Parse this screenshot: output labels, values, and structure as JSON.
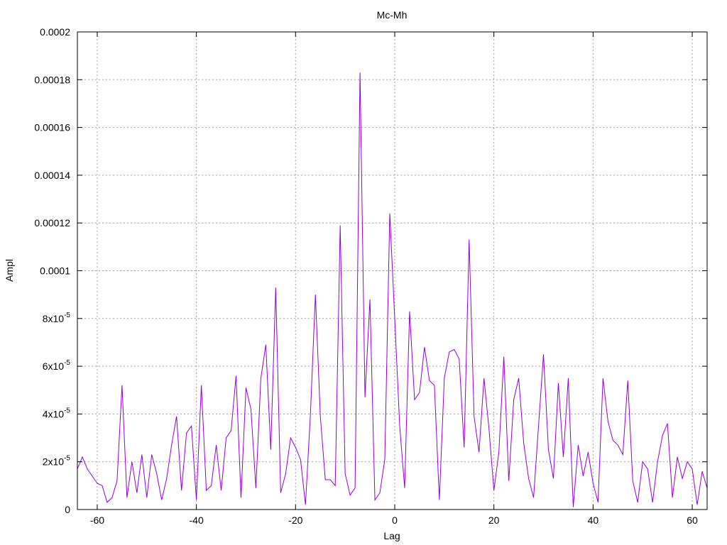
{
  "chart_data": {
    "type": "line",
    "title": "Mc-Mh",
    "xlabel": "Lag",
    "ylabel": "Ampl",
    "xlim": [
      -64,
      63
    ],
    "ylim": [
      0,
      0.0002
    ],
    "grid": true,
    "x_ticks": [
      {
        "value": -60,
        "label": "-60"
      },
      {
        "value": -40,
        "label": "-40"
      },
      {
        "value": -20,
        "label": "-20"
      },
      {
        "value": 0,
        "label": "0"
      },
      {
        "value": 20,
        "label": "20"
      },
      {
        "value": 40,
        "label": "40"
      },
      {
        "value": 60,
        "label": "60"
      }
    ],
    "y_ticks": [
      {
        "value": 0,
        "label": "0",
        "mant": "",
        "exp": ""
      },
      {
        "value": 2e-05,
        "label": "",
        "mant": "2x10",
        "exp": "-5"
      },
      {
        "value": 4e-05,
        "label": "",
        "mant": "4x10",
        "exp": "-5"
      },
      {
        "value": 6e-05,
        "label": "",
        "mant": "6x10",
        "exp": "-5"
      },
      {
        "value": 8e-05,
        "label": "",
        "mant": "8x10",
        "exp": "-5"
      },
      {
        "value": 0.0001,
        "label": "0.0001",
        "mant": "",
        "exp": ""
      },
      {
        "value": 0.00012,
        "label": "0.00012",
        "mant": "",
        "exp": ""
      },
      {
        "value": 0.00014,
        "label": "0.00014",
        "mant": "",
        "exp": ""
      },
      {
        "value": 0.00016,
        "label": "0.00016",
        "mant": "",
        "exp": ""
      },
      {
        "value": 0.00018,
        "label": "0.00018",
        "mant": "",
        "exp": ""
      },
      {
        "value": 0.0002,
        "label": "0.0002",
        "mant": "",
        "exp": ""
      }
    ],
    "series": [
      {
        "color": "#9400d3",
        "x": [
          -64,
          -63,
          -62,
          -61,
          -60,
          -59,
          -58,
          -57,
          -56,
          -55,
          -54,
          -53,
          -52,
          -51,
          -50,
          -49,
          -48,
          -47,
          -46,
          -45,
          -44,
          -43,
          -42,
          -41,
          -40,
          -39,
          -38,
          -37,
          -36,
          -35,
          -34,
          -33,
          -32,
          -31,
          -30,
          -29,
          -28,
          -27,
          -26,
          -25,
          -24,
          -23,
          -22,
          -21,
          -20,
          -19,
          -18,
          -17,
          -16,
          -15,
          -14,
          -13,
          -12,
          -11,
          -10,
          -9,
          -8,
          -7,
          -6,
          -5,
          -4,
          -3,
          -2,
          -1,
          0,
          1,
          2,
          3,
          4,
          5,
          6,
          7,
          8,
          9,
          10,
          11,
          12,
          13,
          14,
          15,
          16,
          17,
          18,
          19,
          20,
          21,
          22,
          23,
          24,
          25,
          26,
          27,
          28,
          29,
          30,
          31,
          32,
          33,
          34,
          35,
          36,
          37,
          38,
          39,
          40,
          41,
          42,
          43,
          44,
          45,
          46,
          47,
          48,
          49,
          50,
          51,
          52,
          53,
          54,
          55,
          56,
          57,
          58,
          59,
          60,
          61,
          62,
          63
        ],
        "y": [
          1.7e-05,
          2.2e-05,
          1.7e-05,
          1.4e-05,
          1.1e-05,
          1e-05,
          3e-06,
          5e-06,
          1.2e-05,
          5.2e-05,
          5e-06,
          2e-05,
          7e-06,
          2.3e-05,
          5e-06,
          2.3e-05,
          1.5e-05,
          4e-06,
          1.3e-05,
          2.7e-05,
          3.9e-05,
          8e-06,
          3.2e-05,
          3.5e-05,
          4e-06,
          5.2e-05,
          8e-06,
          1e-05,
          2.7e-05,
          8e-06,
          3e-05,
          3.3e-05,
          5.6e-05,
          5e-06,
          5.1e-05,
          4.2e-05,
          9e-06,
          5.5e-05,
          6.9e-05,
          2.5e-05,
          9.3e-05,
          7e-06,
          1.5e-05,
          3e-05,
          2.6e-05,
          2.1e-05,
          2e-06,
          4e-05,
          9e-05,
          3.9e-05,
          1.25e-05,
          1.25e-05,
          1e-05,
          0.000119,
          1.5e-05,
          6e-06,
          9e-06,
          0.000183,
          4.7e-05,
          8.8e-05,
          4e-06,
          7e-06,
          2.1e-05,
          0.000124,
          8e-05,
          3.5e-05,
          9e-06,
          8.3e-05,
          4.6e-05,
          4.9e-05,
          6.8e-05,
          5.4e-05,
          5.2e-05,
          4e-06,
          5.5e-05,
          6.6e-05,
          6.7e-05,
          6.3e-05,
          2.6e-05,
          0.000113,
          3.9e-05,
          2.4e-05,
          5.5e-05,
          3.4e-05,
          8e-06,
          2.4e-05,
          6.4e-05,
          1.2e-05,
          4.6e-05,
          5.5e-05,
          2.8e-05,
          1.3e-05,
          5e-06,
          3.5e-05,
          6.5e-05,
          2.5e-05,
          1.3e-05,
          5.3e-05,
          2.2e-05,
          5.5e-05,
          1e-06,
          2.7e-05,
          1.4e-05,
          2.4e-05,
          1.1e-05,
          3e-06,
          5.5e-05,
          3.7e-05,
          2.9e-05,
          2.7e-05,
          2.3e-05,
          5.4e-05,
          1.2e-05,
          3e-06,
          2e-05,
          1.7e-05,
          3e-06,
          2e-05,
          3.1e-05,
          3.6e-05,
          5e-06,
          2.2e-05,
          1.3e-05,
          2e-05,
          1.7e-05,
          2e-06,
          1.6e-05,
          9e-06
        ]
      }
    ]
  }
}
